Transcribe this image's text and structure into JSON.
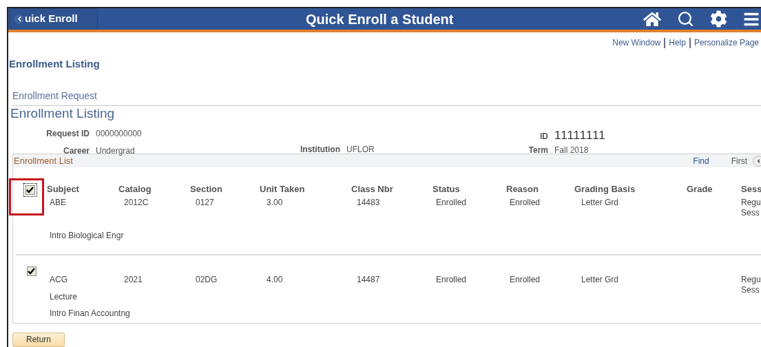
{
  "header": {
    "back_button": "uick Enroll",
    "title": "Quick Enroll a Student"
  },
  "links": [
    "New Window",
    "Help",
    "Personalize Page"
  ],
  "page_title": "Enrollment Listing",
  "section_label": "Enrollment Request",
  "section_title": "Enrollment Listing",
  "fields": {
    "request_id": {
      "label": "Request ID",
      "value": "0000000000"
    },
    "career": {
      "label": "Career",
      "value": "Undergrad"
    },
    "institution": {
      "label": "Institution",
      "value": "UFLOR"
    },
    "id": {
      "label": "ID",
      "value": "11111111"
    },
    "term": {
      "label": "Term",
      "value": "Fall 2018"
    }
  },
  "grid": {
    "title": "Enrollment List",
    "find": "Find",
    "first": "First",
    "columns": [
      "Subject",
      "Catalog",
      "Section",
      "Unit Taken",
      "Class Nbr",
      "Status",
      "Reason",
      "Grading Basis",
      "Grade",
      "Sess"
    ],
    "rows": [
      {
        "checked": true,
        "focused": true,
        "highlighted": true,
        "cells": [
          "ABE",
          "2012C",
          "0127",
          "3.00",
          "14483",
          "Enrolled",
          "Enrolled",
          "Letter Grd",
          ""
        ],
        "session": [
          "Regu",
          "Sess"
        ],
        "component": "",
        "description": "Intro Biological Engr"
      },
      {
        "checked": true,
        "focused": false,
        "highlighted": false,
        "cells": [
          "ACG",
          "2021",
          "02DG",
          "4.00",
          "14487",
          "Enrolled",
          "Enrolled",
          "Letter Grd",
          ""
        ],
        "session": [
          "Regu",
          "Sess"
        ],
        "component": "Lecture",
        "description": "Intro Finan Accountng"
      }
    ]
  },
  "return_button": "Return"
}
